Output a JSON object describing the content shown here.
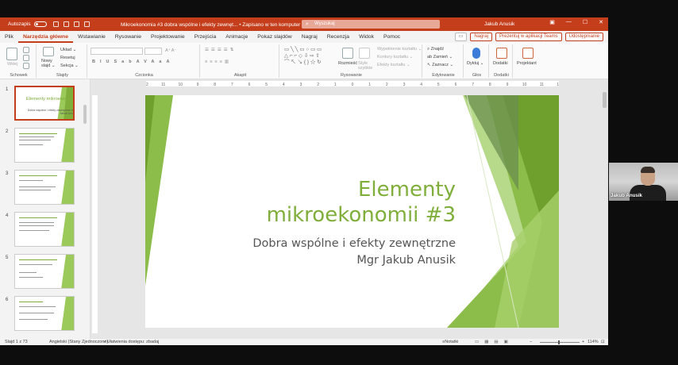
{
  "window": {
    "autosave_label": "Autozapis",
    "doc_title": "Mikroekonomia #3 dobra wspólne i efekty zewnęt... • Zapisano w ten komputer ⌄",
    "search_placeholder": "Wyszukaj",
    "user_name": "Jakub Anusik",
    "controls": [
      "▣",
      "—",
      "☐",
      "✕"
    ]
  },
  "menu": {
    "tabs": [
      "Plik",
      "Narzędzia główne",
      "Wstawianie",
      "Rysowanie",
      "Projektowanie",
      "Przejścia",
      "Animacje",
      "Pokaz slajdów",
      "Nagraj",
      "Recenzja",
      "Widok",
      "Pomoc"
    ],
    "active_tab": "Narzędzia główne",
    "record_label": "Nagraj",
    "teams_label": "Prezentuj w aplikacji Teams",
    "share_label": "Udostępnianie"
  },
  "ribbon": {
    "groups": {
      "clipboard": "Schowek",
      "slides": "Slajdy",
      "font": "Czcionka",
      "paragraph": "Akapit",
      "drawing": "Rysowanie",
      "editing": "Edytowanie",
      "voice": "Głos",
      "addins": "Dodatki"
    },
    "paste_label": "Wklej",
    "new_slide_label": "Nowy slajd ⌄",
    "layout_label": "Układ ⌄",
    "reset_label": "Resetuj",
    "section_label": "Sekcja ⌄",
    "font_buttons": [
      "B",
      "I",
      "U",
      "S",
      "ab",
      "AV",
      "Aa",
      "A"
    ],
    "arrange_label": "Rozmieść",
    "styles_label": "Style szybkie",
    "fill_label": "Wypełnienie kształtu ⌄",
    "outline_label": "Kontury kształtu ⌄",
    "effects_label": "Efekty kształtu ⌄",
    "find_label": "Znajdź",
    "replace_label": "Zamień ⌄",
    "select_label": "Zaznacz ⌄",
    "dictate_label": "Dyktuj ⌄",
    "addins_label": "Dodatki",
    "designer_label": "Projektant"
  },
  "thumbnails": {
    "numbers": [
      "1",
      "2",
      "3",
      "4",
      "5",
      "6"
    ],
    "first_title": "Elementy mikroekonomii #3",
    "first_sub": "Dobra wspólne i efekty zewnętrzne Mgr Jakub Anusik"
  },
  "ruler": {
    "marks": [
      "12",
      "11",
      "10",
      "9",
      "8",
      "7",
      "6",
      "5",
      "4",
      "3",
      "2",
      "1",
      "0",
      "1",
      "2",
      "3",
      "4",
      "5",
      "6",
      "7",
      "8",
      "9",
      "10",
      "11",
      "12"
    ]
  },
  "slide": {
    "title_line1": "Elementy",
    "title_line2": "mikroekonomii #3",
    "subtitle": "Dobra wspólne i efekty zewnętrzne",
    "author": "Mgr Jakub Anusik",
    "accent": "#7fae3a"
  },
  "status": {
    "slide_count": "Slajd 1 z 73",
    "language": "Angielski (Stany Zjednoczone)",
    "accessibility": "Ułatwienia dostępu: zbadaj",
    "notes": "Notatki",
    "zoom": "114%"
  },
  "webcam": {
    "name": "Jakub Anusik"
  },
  "colors": {
    "brand": "#c43e1c",
    "green": "#7fae3a"
  }
}
